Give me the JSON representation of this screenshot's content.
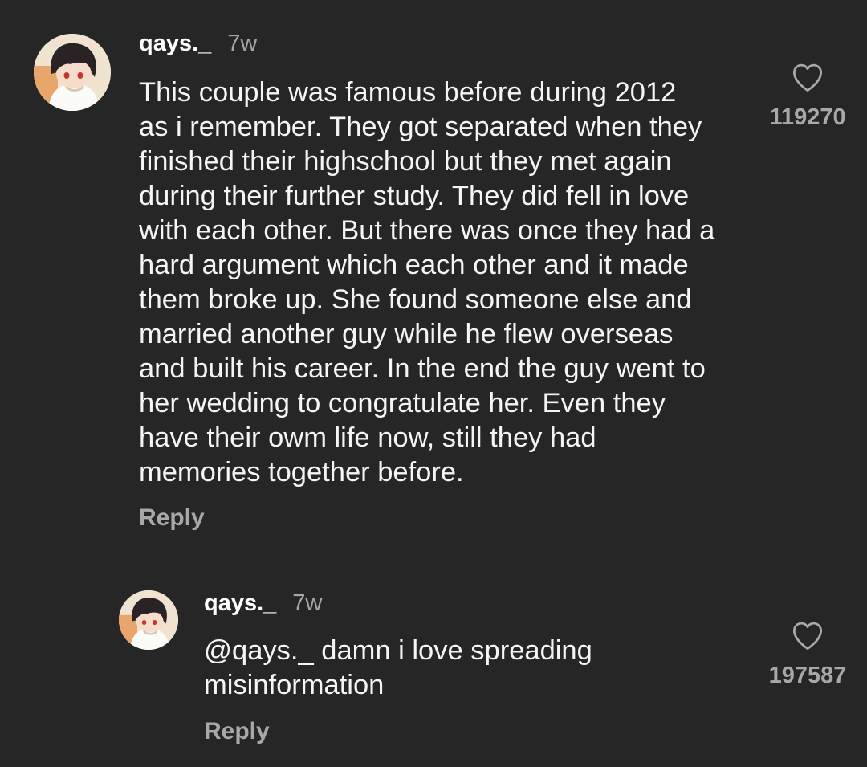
{
  "comments": [
    {
      "username": "qays._",
      "time": "7w",
      "lines": [
        "This couple was famous before during 2012",
        "as i remember. They got separated when they",
        "finished their highschool but they met again",
        "during their further study. They did fell in love",
        "with each other. But there was once they had a",
        "hard argument which each other and it made",
        "them broke up. She found someone else and",
        "married another guy while he flew overseas",
        "and built his career. In the end the guy went to",
        "her wedding to congratulate her. Even they",
        "have their owm life now, still they had",
        "memories together before."
      ],
      "reply_label": "Reply",
      "likes": "119270",
      "like_icon": "heart-outline-icon"
    },
    {
      "username": "qays._",
      "time": "7w",
      "lines": [
        "@qays._ damn i love spreading",
        "misinformation"
      ],
      "reply_label": "Reply",
      "likes": "197587",
      "like_icon": "heart-outline-icon"
    }
  ],
  "colors": {
    "background": "#262626",
    "text": "#f5f5f5",
    "muted": "#a8a8a8"
  }
}
